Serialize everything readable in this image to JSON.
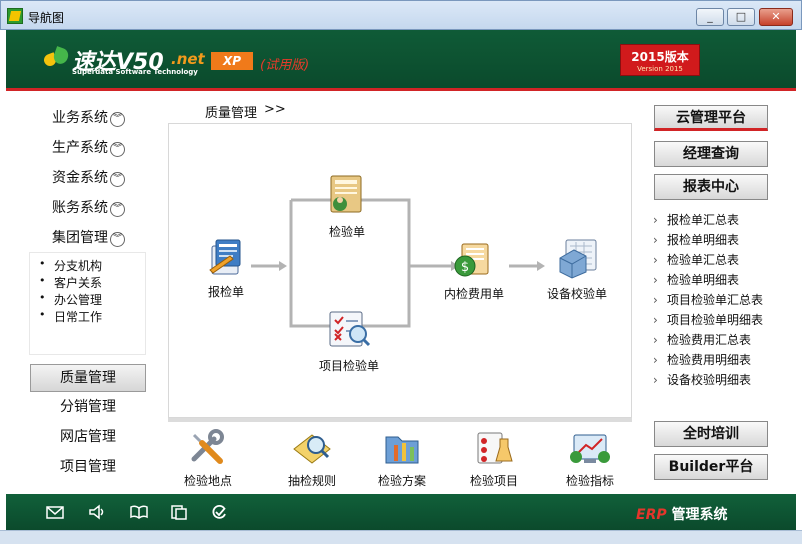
{
  "window": {
    "title": "导航图",
    "min_label": "▭",
    "max_label": "□",
    "close_label": "✕"
  },
  "header": {
    "logo_main": "速达V50",
    "logo_net": ".net",
    "logo_sub": "Superdata Software Technology",
    "xp": "XP",
    "trial": "(试用版)",
    "version": "2015版本",
    "version_sub": "Version 2015"
  },
  "left": {
    "systems": [
      "业务系统",
      "生产系统",
      "资金系统",
      "账务系统",
      "集团管理"
    ],
    "group_items": [
      "分支机构",
      "客户关系",
      "办公管理",
      "日常工作"
    ],
    "modules": [
      "质量管理",
      "分销管理",
      "网店管理",
      "项目管理"
    ],
    "active_module": "质量管理"
  },
  "breadcrumb": {
    "title": "质量管理",
    "sep": ">>"
  },
  "flow": {
    "report": "报检单",
    "inspect": "检验单",
    "item_inspect": "项目检验单",
    "internal_fee": "内检费用单",
    "calibration": "设备校验单"
  },
  "tools": [
    "检验地点",
    "抽检规则",
    "检验方案",
    "检验项目",
    "检验指标"
  ],
  "right": {
    "cloud": "云管理平台",
    "manager": "经理查询",
    "reports": "报表中心",
    "report_items": [
      "报检单汇总表",
      "报检单明细表",
      "检验单汇总表",
      "检验单明细表",
      "项目检验单汇总表",
      "项目检验单明细表",
      "检验费用汇总表",
      "检验费用明细表",
      "设备校验明细表"
    ],
    "training": "全时培训",
    "builder": "Builder平台"
  },
  "footer": {
    "erp": "ERP",
    "brand": "管理系统"
  },
  "colors": {
    "header_green": "#0f5b37",
    "accent_red": "#d12426",
    "logo_orange": "#f07a1a"
  }
}
